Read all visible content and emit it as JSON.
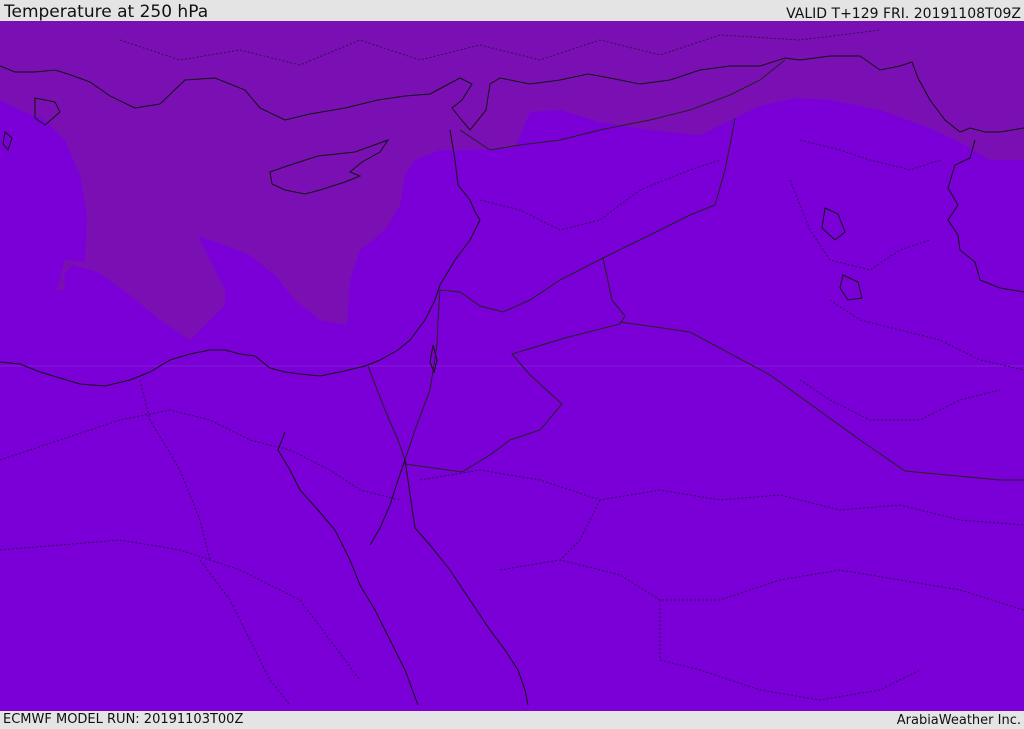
{
  "header": {
    "title": "Temperature at 250 hPa",
    "valid_time": "VALID T+129 FRI. 20191108T09Z"
  },
  "footer": {
    "model_run": "ECMWF MODEL RUN: 20191103T00Z",
    "credit": "ArabiaWeather Inc."
  },
  "map": {
    "colors": {
      "fill_warm": "#7b00d8",
      "fill_cold": "#7a10b3",
      "coastline": "#111111",
      "border": "#222222"
    }
  }
}
